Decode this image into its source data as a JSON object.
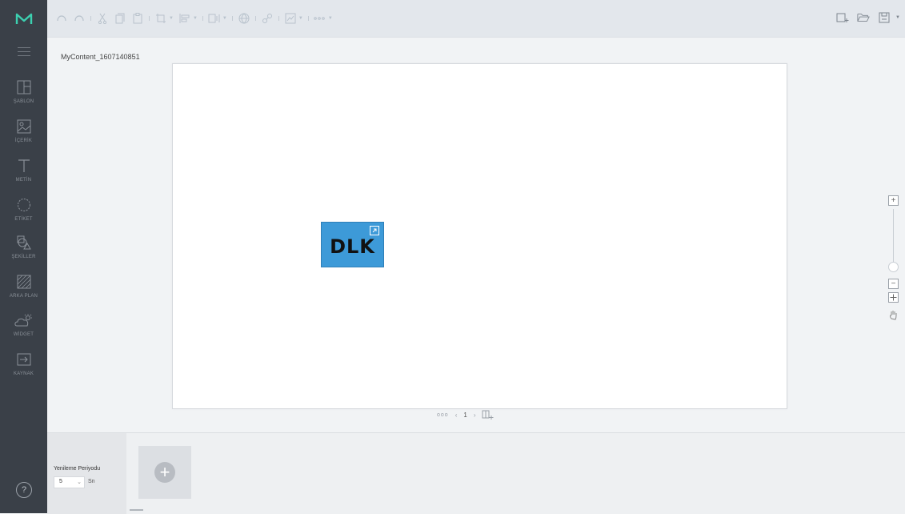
{
  "app": {
    "brand_color": "#3cd0b0"
  },
  "sidebar": {
    "items": [
      {
        "label": "ŞABLON",
        "icon": "template-icon"
      },
      {
        "label": "İÇERİK",
        "icon": "image-icon"
      },
      {
        "label": "METİN",
        "icon": "text-icon"
      },
      {
        "label": "ETİKET",
        "icon": "tag-icon"
      },
      {
        "label": "ŞEKİLLER",
        "icon": "shapes-icon"
      },
      {
        "label": "ARKA PLAN",
        "icon": "background-icon"
      },
      {
        "label": "WİDGET",
        "icon": "weather-widget-icon"
      },
      {
        "label": "KAYNAK",
        "icon": "source-icon"
      }
    ],
    "help": "?"
  },
  "workspace": {
    "content_title": "MyContent_1607140851",
    "widget_text": "DLK",
    "page_number": "1",
    "pager_dots": "ooo",
    "widget_color": "#3d9ad8"
  },
  "bottom": {
    "period_label": "Yenileme Periyodu",
    "period_value": "5",
    "period_unit": "Sn"
  }
}
